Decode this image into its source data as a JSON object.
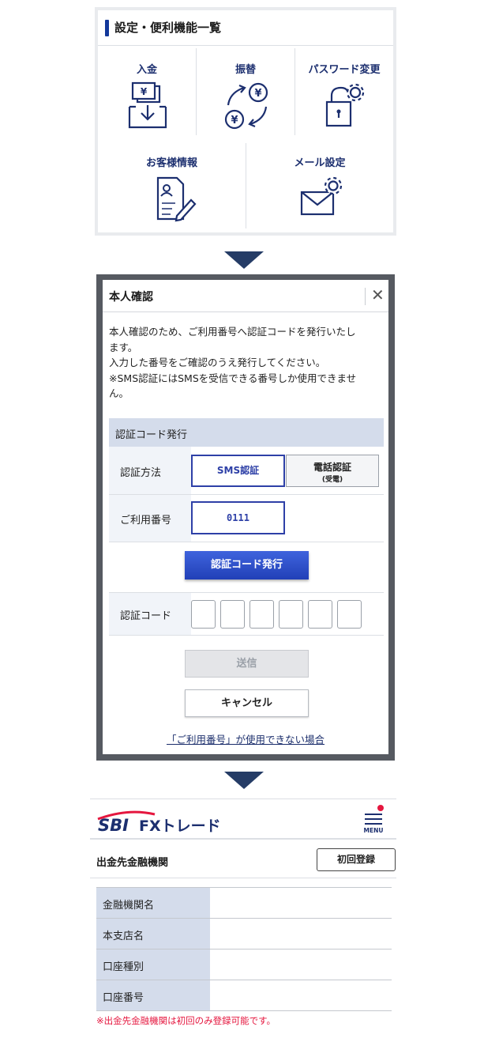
{
  "settings_panel": {
    "title": "設定・便利機能一覧",
    "items": [
      {
        "label": "入金",
        "icon": "deposit-icon"
      },
      {
        "label": "振替",
        "icon": "transfer-icon"
      },
      {
        "label": "パスワード変更",
        "icon": "password-change-icon"
      },
      {
        "label": "お客様情報",
        "icon": "customer-info-icon"
      },
      {
        "label": "メール設定",
        "icon": "mail-settings-icon"
      }
    ],
    "icon_color": "#1c2f6f"
  },
  "dialog": {
    "title": "本人確認",
    "close_label": "✕",
    "description": [
      "本人確認のため、ご利用番号へ認証コードを発行いたし",
      "ます。",
      "入力した番号をご確認のうえ発行してください。",
      "※SMS認証にはSMSを受信できる番号しか使用できませ",
      "ん。"
    ],
    "section_title": "認証コード発行",
    "auth_method_label": "認証方法",
    "auth_methods": {
      "sms": "SMS認証",
      "phone": "電話認証",
      "phone_sub": "(受電)"
    },
    "number_label": "ご利用番号",
    "number_value": "0111",
    "issue_button": "認証コード発行",
    "code_label": "認証コード",
    "send_button": "送信",
    "cancel_button": "キャンセル",
    "help_link": "「ご利用番号」が使用できない場合",
    "accent_color": "#2e40a7"
  },
  "fx_page": {
    "logo_sbi": "SBI",
    "logo_fx": "FXトレード",
    "menu_label": "MENU",
    "section_title": "出金先金融機関",
    "register_button": "初回登録",
    "table_rows": [
      {
        "key": "金融機関名",
        "value": ""
      },
      {
        "key": "本支店名",
        "value": ""
      },
      {
        "key": "口座種別",
        "value": ""
      },
      {
        "key": "口座番号",
        "value": ""
      }
    ],
    "note": "※出金先金融機関は初回のみ登録可能です。",
    "brand_red": "#e5173f",
    "brand_navy": "#1c2f6f"
  }
}
